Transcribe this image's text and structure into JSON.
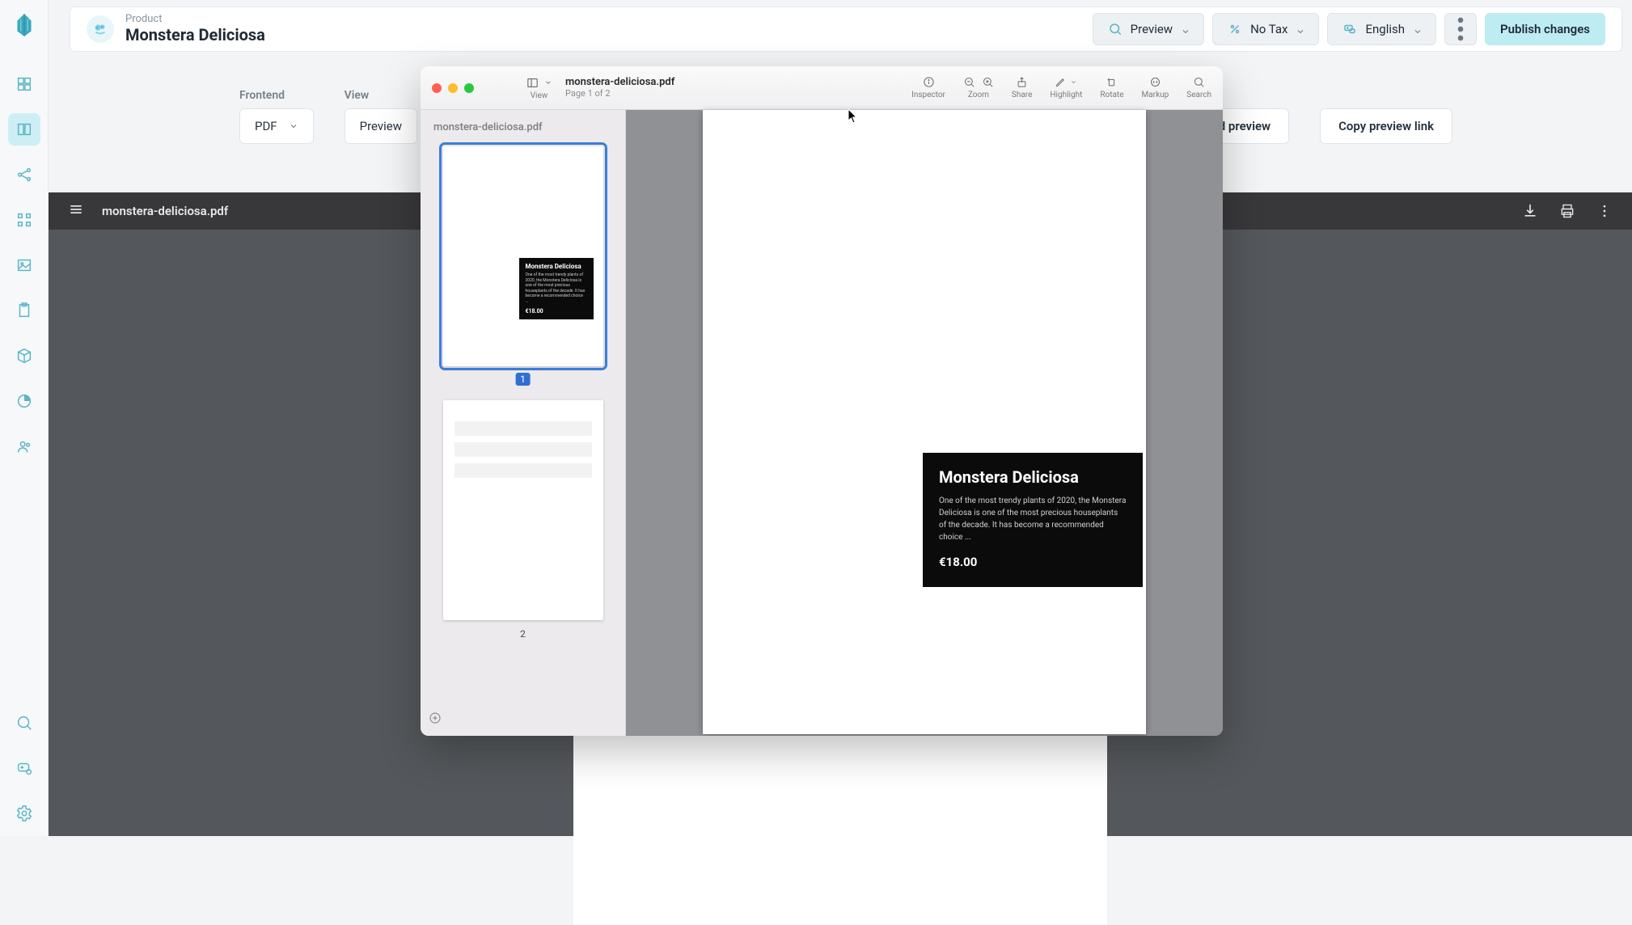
{
  "breadcrumb": {
    "category": "Product",
    "title": "Monstera Deliciosa"
  },
  "header_buttons": {
    "preview": "Preview",
    "tax": "No Tax",
    "language": "English",
    "publish": "Publish changes"
  },
  "subrow": {
    "frontend_label": "Frontend",
    "frontend_value": "PDF",
    "view_label": "View",
    "view_value": "Preview",
    "download_preview": "load preview",
    "copy_link": "Copy preview link"
  },
  "pdfbar": {
    "filename": "monstera-deliciosa.pdf"
  },
  "underpage": {
    "title": "Monstera Deliciosa",
    "desc": "One of the most trendy plants of 2020, the Monstera Deliciosa is one of the most precious houseplants of the decade. It has become a recommended choice  ...",
    "price_badge": "€18.00"
  },
  "macwin": {
    "view_label": "View",
    "filename": "monstera-deliciosa.pdf",
    "page_indicator": "Page 1 of 2",
    "sidebar_label": "monstera-deliciosa.pdf",
    "thumbs": [
      {
        "num": "1",
        "selected": true
      },
      {
        "num": "2",
        "selected": false
      }
    ],
    "toolbar": {
      "inspector": "Inspector",
      "zoom": "Zoom",
      "share": "Share",
      "highlight": "Highlight",
      "rotate": "Rotate",
      "markup": "Markup",
      "search": "Search"
    },
    "page": {
      "title": "Monstera Deliciosa",
      "desc": "One of the most trendy plants of 2020, the Monstera Deliciosa is one of the most precious houseplants of the decade. It has become a recommended choice   ...",
      "price": "€18.00"
    }
  }
}
